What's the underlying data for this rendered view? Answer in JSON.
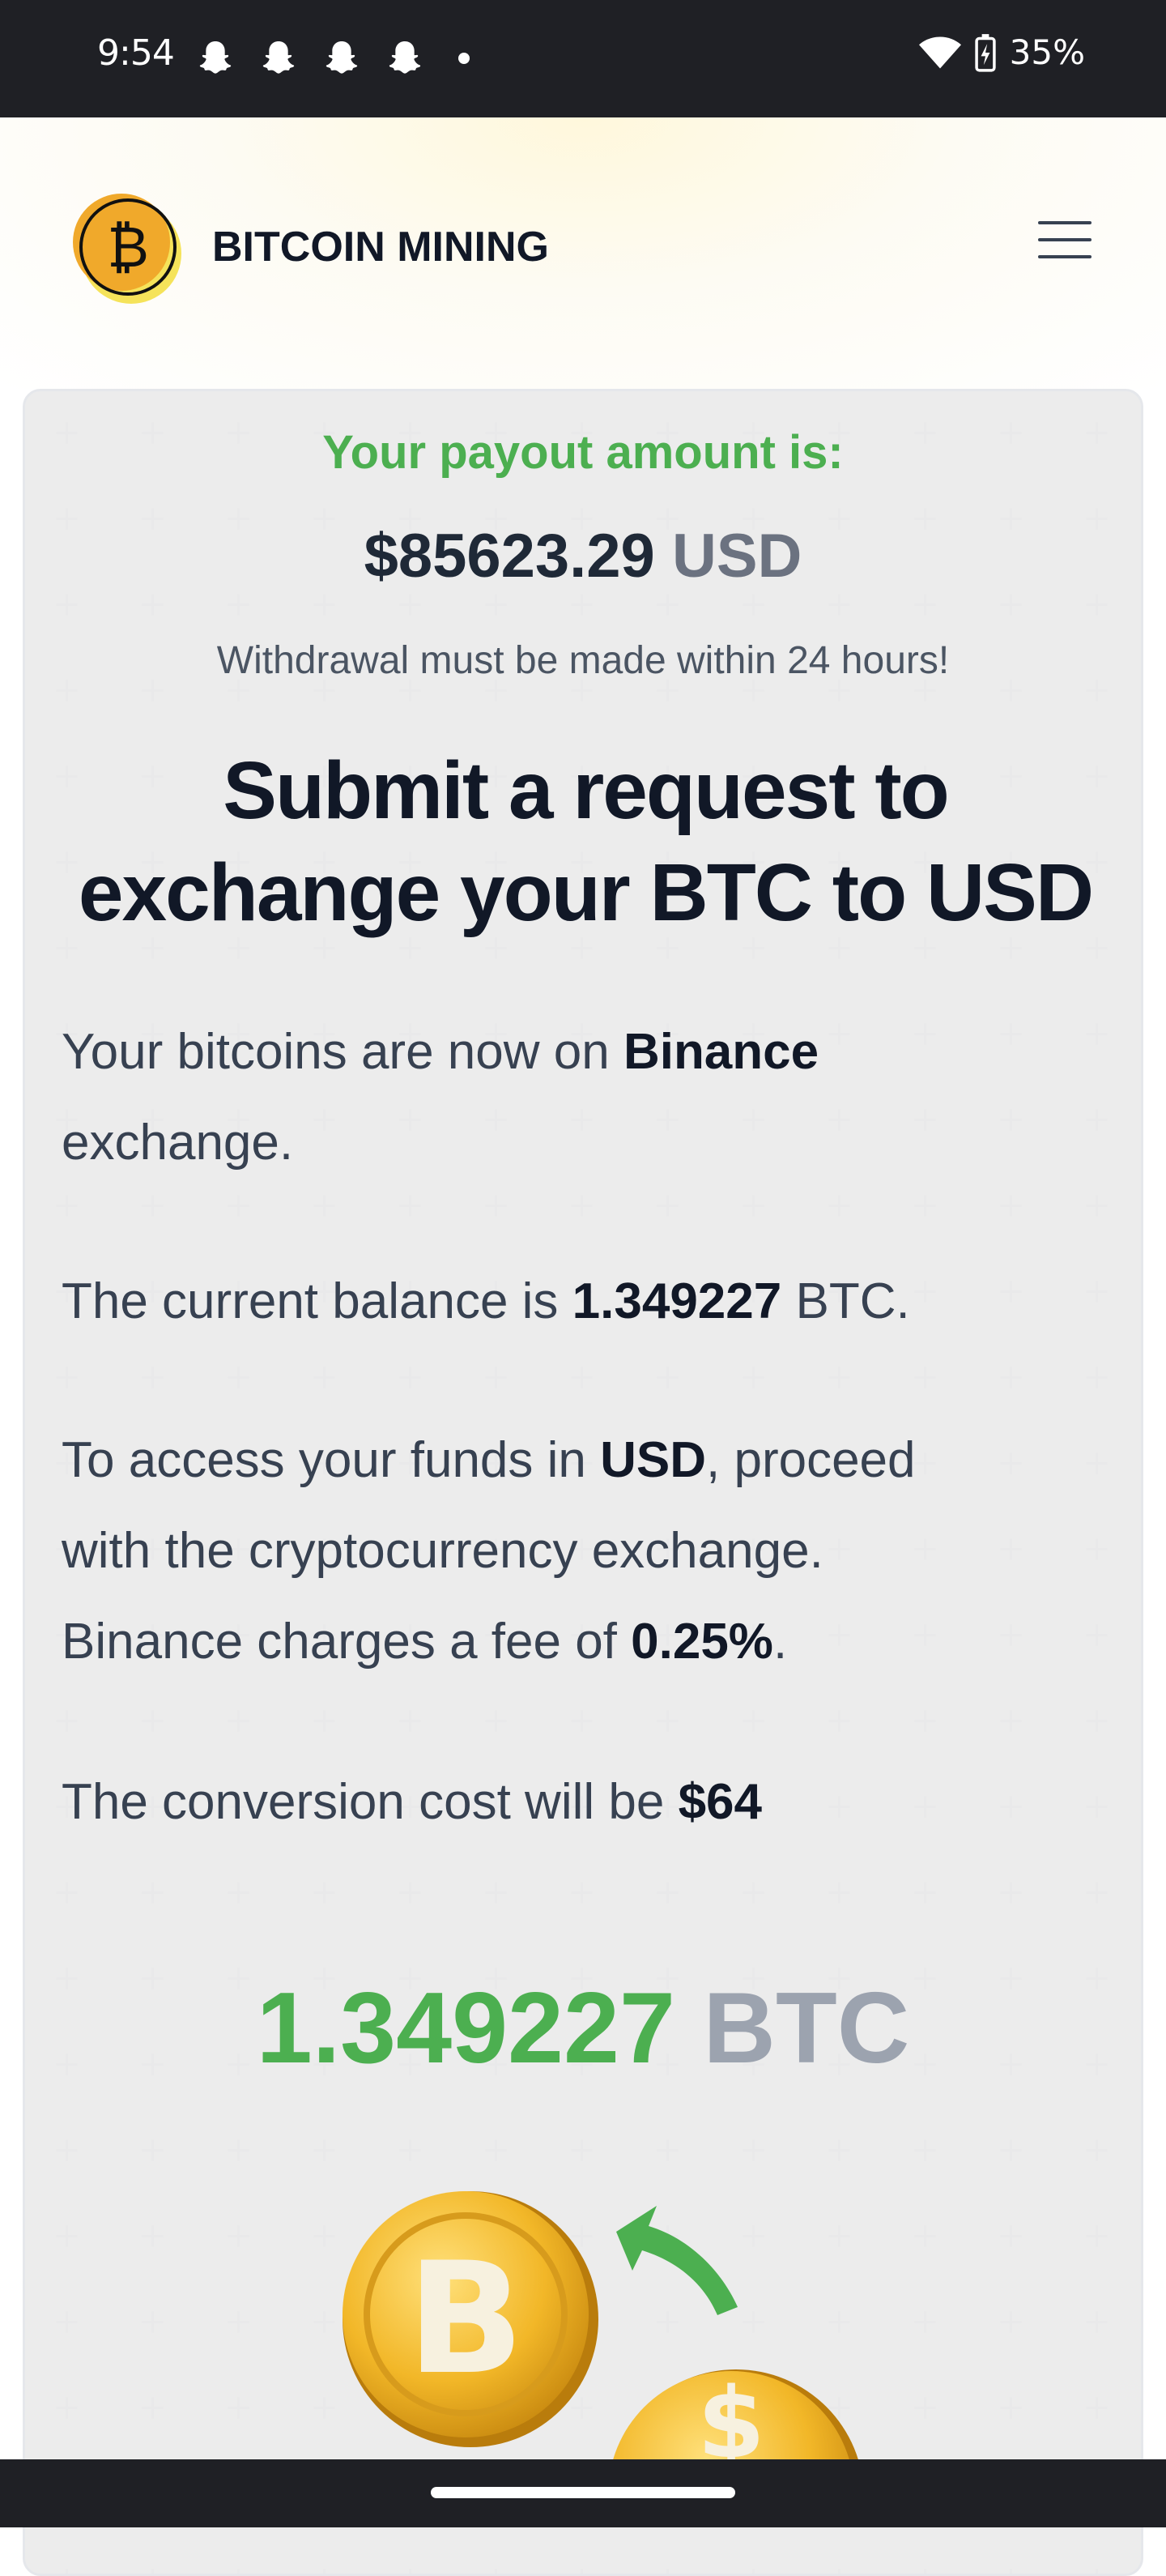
{
  "status_bar": {
    "time": "9:54",
    "battery": "35%",
    "notification_icons": [
      "snapchat-icon",
      "snapchat-icon",
      "snapchat-icon",
      "snapchat-icon"
    ]
  },
  "header": {
    "brand": "BITCOIN MINING",
    "menu_icon": "hamburger-menu-icon"
  },
  "payout": {
    "label": "Your payout amount is:",
    "amount": "$85623.29",
    "unit": "USD",
    "note": "Withdrawal must be made within 24 hours!"
  },
  "headline": {
    "line1": "Submit a request to",
    "line2": "exchange your BTC to USD"
  },
  "paragraphs": {
    "p1_pre": "Your bitcoins are now on ",
    "p1_bold": "Binance",
    "p1_post": "exchange.",
    "p2_pre": "The current balance is ",
    "p2_bold": "1.349227",
    "p2_post": " BTC.",
    "p3_pre": "To access your funds in ",
    "p3_bold1": "USD",
    "p3_mid1": ", proceed",
    "p3_line2": "with the cryptocurrency exchange.",
    "p3_line3_pre": "Binance charges a fee of ",
    "p3_bold2": "0.25%",
    "p3_line3_post": ".",
    "p4_pre": "The conversion cost will be ",
    "p4_bold": "$64"
  },
  "btc_amount": {
    "number": "1.349227",
    "unit": "BTC"
  },
  "colors": {
    "accent_green": "#4caf50",
    "status_bar_bg": "#1f2025",
    "text_dark": "#111827",
    "text_muted": "#6b7280"
  }
}
